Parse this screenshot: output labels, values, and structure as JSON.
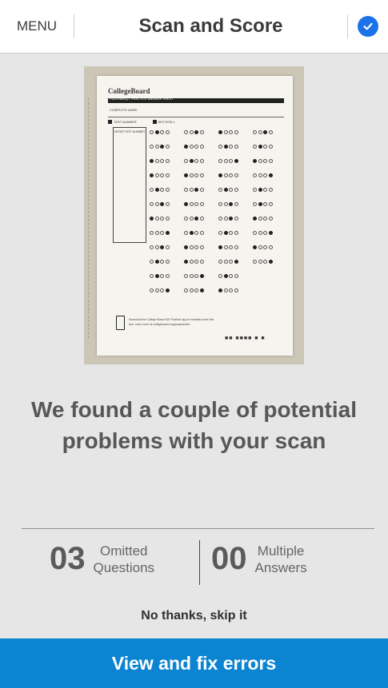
{
  "header": {
    "menu_label": "MENU",
    "title": "Scan and Score",
    "confirm_icon": "check-circle-icon"
  },
  "scan_image": {
    "brand": "CollegeBoard",
    "sheet_title": "PSAT/NMSQT PRACTICE ANSWER SHEET",
    "complete_mark_label": "COMPLETE MARK",
    "incomplete_marks_label": "EXAMPLES OF INCOMPLETE MARKS",
    "test_number_label": "TEST NUMBER",
    "section_label": "SECTION 1",
    "enter_test_number_label": "ENTER TEST NUMBER",
    "footer_text": "Download the College Board SAT Practice app to instantly score this test. Learn more at collegeboard.org/psatpractice."
  },
  "message": "We found a couple of potential problems with your scan",
  "stats": [
    {
      "value": "03",
      "label_line1": "Omitted",
      "label_line2": "Questions"
    },
    {
      "value": "00",
      "label_line1": "Multiple",
      "label_line2": "Answers"
    }
  ],
  "skip_label": "No thanks, skip it",
  "cta_label": "View and fix errors",
  "colors": {
    "accent": "#0b84d2",
    "check_icon": "#1a73e8",
    "background": "#e6e6e6"
  }
}
